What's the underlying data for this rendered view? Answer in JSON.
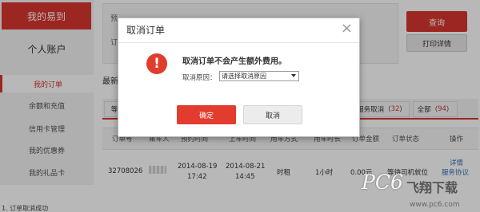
{
  "sidebar": {
    "brand": "我的易到",
    "personal": "个人账户",
    "items": [
      {
        "label": "我的订单",
        "active": true
      },
      {
        "label": "余额和充值"
      },
      {
        "label": "信用卡管理"
      },
      {
        "label": "我的优惠券"
      },
      {
        "label": "我的礼品卡"
      }
    ]
  },
  "filters": {
    "label1": "预",
    "label2": "订"
  },
  "buttons": {
    "query": "查询",
    "print": "打印详情"
  },
  "section_title": "最新",
  "tabs": [
    {
      "label": "等"
    },
    {
      "label": "服务取消",
      "count": "32"
    },
    {
      "label": "全部",
      "count": "94"
    }
  ],
  "table": {
    "headers": [
      "订单号",
      "乘车人",
      "预约时间",
      "上车时间",
      "用车方式",
      "用车时长",
      "订单金额",
      "订单状态",
      "操作"
    ],
    "row": {
      "order_id": "32708026",
      "reserve_date": "2014-08-19",
      "reserve_time": "17:42",
      "board_date": "2014-08-21",
      "board_time": "14:45",
      "mode": "时租",
      "duration": "1小时",
      "amount": "0.00元",
      "status": "等待司机就位",
      "action1": "详情",
      "action2": "服务协议"
    }
  },
  "bottom_text": "1. 订单取消成功",
  "dialog": {
    "title": "取消订单",
    "close_glyph": "×",
    "icon_glyph": "!",
    "message": "取消订单不会产生额外费用。",
    "reason_label": "取消原因：",
    "reason_selected": "请选择取消原因",
    "ok": "确定",
    "cancel": "取消"
  },
  "watermark": {
    "brand": "PC6",
    "cn": "飞翔下载",
    "url": "www.pc6.com"
  },
  "colors": {
    "accent": "#d9352e",
    "link": "#3a6fb5"
  }
}
